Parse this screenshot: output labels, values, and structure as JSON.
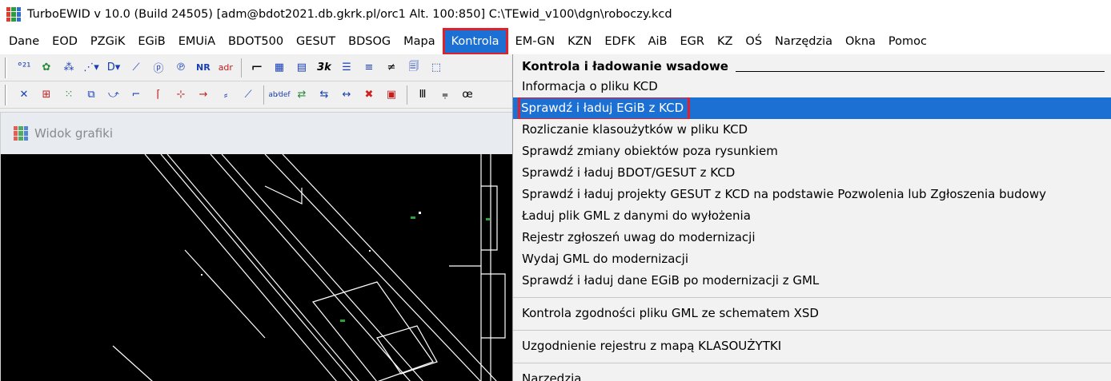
{
  "window": {
    "title": "TurboEWID v 10.0 (Build 24505) [adm@bdot2021.db.gkrk.pl/orc1 Alt. 100:850]   C:\\TEwid_v100\\dgn\\roboczy.kcd"
  },
  "menubar": {
    "items": [
      "Dane",
      "EOD",
      "PZGiK",
      "EGiB",
      "EMUiA",
      "BDOT500",
      "GESUT",
      "BDSOG",
      "Mapa",
      "Kontrola",
      "EM-GN",
      "KZN",
      "EDFK",
      "AiB",
      "EGR",
      "KZ",
      "OŚ",
      "Narzędzia",
      "Okna",
      "Pomoc"
    ],
    "active": "Kontrola"
  },
  "toolbar1": {
    "icons": [
      "points-numbering-icon",
      "layer-group-icon",
      "objects-icon",
      "objects-dropdown-icon",
      "d-dropdown-icon",
      "line-icon",
      "p-box-icon",
      "rotated-p-icon"
    ],
    "text_buttons": {
      "nr": "NR",
      "adr": "adr"
    }
  },
  "graphics_window": {
    "title": "Widok grafiki"
  },
  "dropdown": {
    "header": "Kontrola i ładowanie wsadowe",
    "group1": [
      "Informacja o pliku KCD",
      "Sprawdź i ładuj EGiB z KCD",
      "Rozliczanie klasoużytków w pliku KCD",
      "Sprawdź zmiany obiektów poza rysunkiem",
      "Sprawdź i ładuj BDOT/GESUT z KCD",
      "Sprawdź i ładuj projekty GESUT z KCD na podstawie Pozwolenia lub Zgłoszenia budowy",
      "Ładuj plik GML z danymi do wyłożenia",
      "Rejestr zgłoszeń uwag do modernizacji",
      "Wydaj GML do modernizacji",
      "Sprawdź i ładuj dane EGiB po modernizacji z GML"
    ],
    "group2": [
      "Kontrola zgodności pliku GML ze schematem XSD"
    ],
    "group3": [
      "Uzgodnienie rejestru z mapą KLASOUŻYTKI"
    ],
    "group4": [
      "Narzędzia"
    ],
    "highlighted": "Sprawdź i ładuj EGiB z KCD"
  },
  "colors": {
    "accent": "#1c6fd3",
    "highlight_border": "#e0202a",
    "canvas_bg": "#000000"
  }
}
